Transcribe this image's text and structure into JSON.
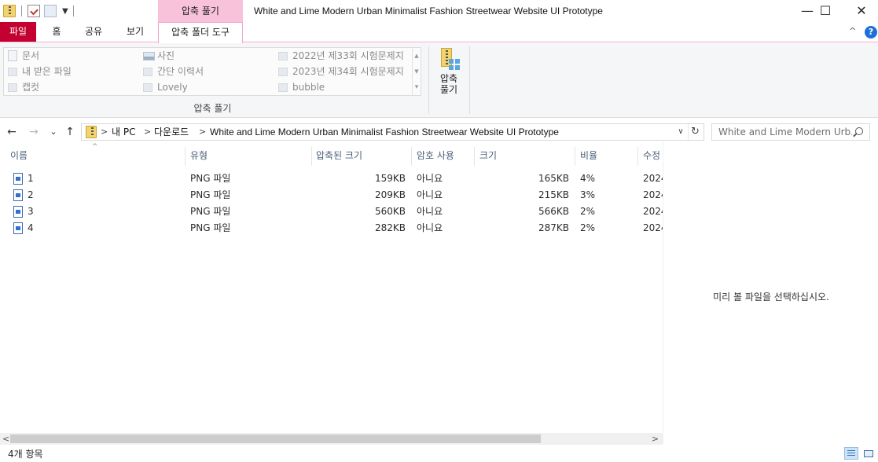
{
  "window": {
    "title": "White and Lime Modern Urban Minimalist Fashion Streetwear Website UI Prototype",
    "context_tab_header": "압축 풀기",
    "controls": {
      "minimize": "—",
      "maximize": "☐",
      "close": "✕"
    }
  },
  "ribbon": {
    "tabs": [
      {
        "label": "파일"
      },
      {
        "label": "홈"
      },
      {
        "label": "공유"
      },
      {
        "label": "보기"
      },
      {
        "label": "압축 폴더 도구"
      }
    ],
    "active_tab": "압축 폴더 도구",
    "collapse_glyph": "^",
    "help_glyph": "?",
    "gallery": {
      "items": [
        {
          "label": "문서",
          "icon": "document-icon"
        },
        {
          "label": "내 받은 파일",
          "icon": "folder-icon"
        },
        {
          "label": "캡컷",
          "icon": "folder-icon"
        },
        {
          "label": "사진",
          "icon": "pictures-icon"
        },
        {
          "label": "간단 이력서",
          "icon": "folder-icon"
        },
        {
          "label": "Lovely",
          "icon": "folder-icon"
        },
        {
          "label": "2022년 제33회 시험문제지",
          "icon": "folder-icon"
        },
        {
          "label": "2023년 제34회 시험문제지",
          "icon": "folder-icon"
        },
        {
          "label": "bubble",
          "icon": "folder-icon"
        }
      ],
      "scroll_up": "▲",
      "scroll_down": "▼",
      "scroll_more": "▾"
    },
    "group_label": "압축 풀기",
    "extract_all": {
      "line1": "압축",
      "line2": "풀기"
    }
  },
  "navigation": {
    "back": "←",
    "forward": "→",
    "recent": "⌄",
    "up": "↑",
    "breadcrumb": [
      "내 PC",
      "다운로드",
      "White and Lime Modern Urban Minimalist Fashion Streetwear Website UI Prototype"
    ],
    "separator": ">",
    "dropdown": "∨",
    "refresh": "↻",
    "search_placeholder": "White and Lime Modern Urb..."
  },
  "file_list": {
    "columns": [
      "이름",
      "유형",
      "압축된 크기",
      "암호 사용",
      "크기",
      "비율",
      "수정"
    ],
    "sort_indicator": "^",
    "rows": [
      {
        "name": "1",
        "type": "PNG 파일",
        "packed": "159KB",
        "password": "아니요",
        "size": "165KB",
        "ratio": "4%",
        "modified": "2024"
      },
      {
        "name": "2",
        "type": "PNG 파일",
        "packed": "209KB",
        "password": "아니요",
        "size": "215KB",
        "ratio": "3%",
        "modified": "2024"
      },
      {
        "name": "3",
        "type": "PNG 파일",
        "packed": "560KB",
        "password": "아니요",
        "size": "566KB",
        "ratio": "2%",
        "modified": "2024"
      },
      {
        "name": "4",
        "type": "PNG 파일",
        "packed": "282KB",
        "password": "아니요",
        "size": "287KB",
        "ratio": "2%",
        "modified": "2024"
      }
    ]
  },
  "preview_pane": {
    "message": "미리 볼 파일을 선택하십시오."
  },
  "scrollbar": {
    "left": "<",
    "right": ">",
    "thumb_fraction": 0.83
  },
  "status_bar": {
    "item_count": "4개 항목"
  },
  "colors": {
    "file_tab": "#c3002f",
    "context_tab": "#f8c2da",
    "accent": "#1e6fd9"
  }
}
